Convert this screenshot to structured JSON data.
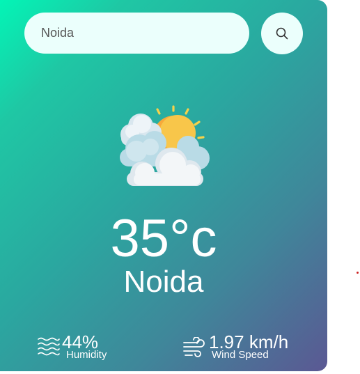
{
  "search": {
    "value": "Noida",
    "placeholder": ""
  },
  "search_button": {
    "icon": "search-icon"
  },
  "weather": {
    "icon": "sun-behind-clouds-icon",
    "temperature": "35°c",
    "city": "Noida"
  },
  "stats": {
    "humidity": {
      "icon": "humidity-waves-icon",
      "value": "44%",
      "label": "Humidity"
    },
    "wind": {
      "icon": "wind-icon",
      "value": "1.97 km/h",
      "label": "Wind Speed"
    }
  },
  "colors": {
    "gradient_start": "#03f5b6",
    "gradient_end": "#5b5893",
    "input_background": "#ebfffc",
    "text": "#ffffff"
  }
}
